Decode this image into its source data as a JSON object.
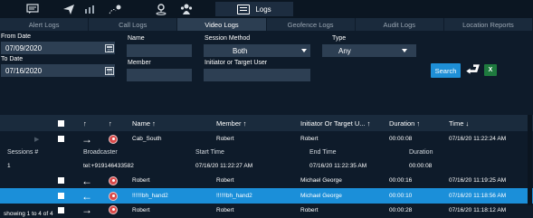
{
  "app": {
    "active_module": "Logs"
  },
  "top_icons": [
    "message-icon",
    "send-icon",
    "broadcast-icon",
    "map-pin-icon",
    "location-icon",
    "people-icon"
  ],
  "tabs": [
    {
      "label": "Alert Logs",
      "active": false
    },
    {
      "label": "Call Logs",
      "active": false
    },
    {
      "label": "Video Logs",
      "active": true
    },
    {
      "label": "Geofence Logs",
      "active": false
    },
    {
      "label": "Audit Logs",
      "active": false
    },
    {
      "label": "Location Reports",
      "active": false
    }
  ],
  "filters": {
    "from_date_label": "From Date",
    "from_date_value": "07/09/2020",
    "to_date_label": "To Date",
    "to_date_value": "07/16/2020",
    "name_label": "Name",
    "name_value": "",
    "member_label": "Member",
    "member_value": "",
    "session_method_label": "Session Method",
    "session_method_value": "Both",
    "type_label": "Type",
    "type_value": "Any",
    "initiator_label": "Initiator or Target User",
    "initiator_value": "",
    "search_label": "Search",
    "export_label": "X"
  },
  "table": {
    "headers": {
      "name": "Name ↑",
      "member": "Member ↑",
      "initiator": "Initiator Or Target U... ↑",
      "duration": "Duration ↑",
      "time": "Time ↓",
      "col_arrow1": "↑",
      "col_arrow2": "↑"
    },
    "rows": [
      {
        "direction": "→",
        "name": "Cab_South",
        "member": "Robert",
        "initiator": "Robert",
        "duration": "00:00:08",
        "time": "07/16/20 11:22:24 AM",
        "expanded": true,
        "selected": false
      },
      {
        "direction": "←",
        "name": "Robert",
        "member": "Robert",
        "initiator": "Michael George",
        "duration": "00:00:16",
        "time": "07/16/20 11:19:25 AM",
        "selected": false
      },
      {
        "direction": "←",
        "name": "!!!!!!bh_hand2",
        "member": "!!!!!!bh_hand2",
        "initiator": "Michael George",
        "duration": "00:00:10",
        "time": "07/16/20 11:18:56 AM",
        "selected": true
      },
      {
        "direction": "→",
        "name": "Robert",
        "member": "Robert",
        "initiator": "Robert",
        "duration": "00:00:28",
        "time": "07/16/20 11:18:12 AM",
        "selected": false
      }
    ],
    "session_detail": {
      "headers": {
        "sessions": "Sessions #",
        "broadcaster": "Broadcaster",
        "start": "Start Time",
        "end": "End Time",
        "duration": "Duration"
      },
      "values": {
        "sessions": "1",
        "broadcaster": "tel:+919146433582",
        "start": "07/16/20 11:22:27 AM",
        "end": "07/16/20 11:22:35 AM",
        "duration": "00:00:08"
      }
    },
    "footer": "showing 1 to 4 of 4"
  }
}
